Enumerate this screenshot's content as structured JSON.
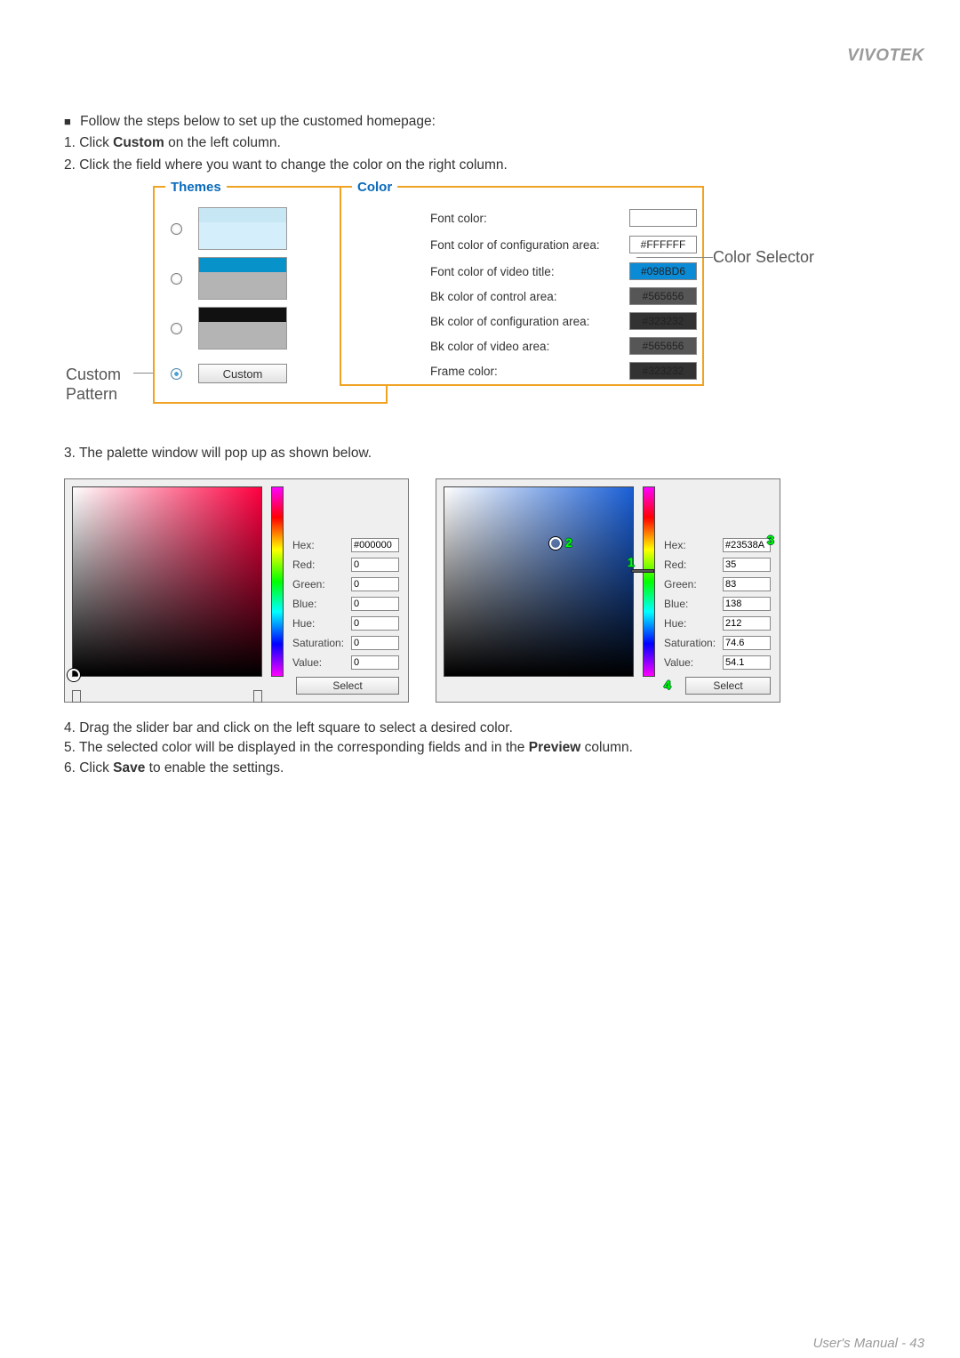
{
  "brand": "VIVOTEK",
  "intro": {
    "lead": "Follow the steps below to set up the customed homepage:",
    "s1a": "1. Click ",
    "s1b": "Custom",
    "s1c": " on the left column.",
    "s2": "2. Click the field where you want to change the color on the right column."
  },
  "themes": {
    "legend": "Themes",
    "custom_btn": "Custom",
    "side_label": "Custom\nPattern"
  },
  "color": {
    "legend": "Color",
    "rows": {
      "font_color": "Font color:",
      "font_cfg": "Font color of configuration area:",
      "font_vt": "Font color of video title:",
      "bk_ctrl": "Bk color of control area:",
      "bk_cfg": "Bk color of configuration area:",
      "bk_video": "Bk color of video area:",
      "frame": "Frame color:"
    },
    "vals": {
      "font_cfg": "#FFFFFF",
      "font_vt": "#098BD6",
      "bk_ctrl": "#565656",
      "bk_cfg": "#323232",
      "bk_video": "#565656",
      "frame": "#323232"
    },
    "annot": "Color Selector"
  },
  "step3": "3. The palette window will pop up as shown below.",
  "palette_labels": {
    "hex": "Hex:",
    "red": "Red:",
    "green": "Green:",
    "blue": "Blue:",
    "hue": "Hue:",
    "saturation": "Saturation:",
    "value": "Value:",
    "select": "Select"
  },
  "palette1": {
    "hex": "#000000",
    "red": "0",
    "green": "0",
    "blue": "0",
    "hue": "0",
    "saturation": "0",
    "value": "0"
  },
  "palette2": {
    "hex": "#23538A",
    "red": "35",
    "green": "83",
    "blue": "138",
    "hue": "212",
    "saturation": "74.6",
    "value": "54.1"
  },
  "badges": {
    "b1": "1",
    "b2": "2",
    "b3": "3",
    "b4": "4"
  },
  "after": {
    "s4": "4. Drag the slider bar and click on the left square to select a desired color.",
    "s5a": "5. The selected color will be displayed in the corresponding fields and in the ",
    "s5b": "Preview",
    "s5c": " column.",
    "s6a": "6. Click ",
    "s6b": "Save",
    "s6c": " to enable the settings."
  },
  "footer": {
    "text": "User's Manual - 43"
  }
}
